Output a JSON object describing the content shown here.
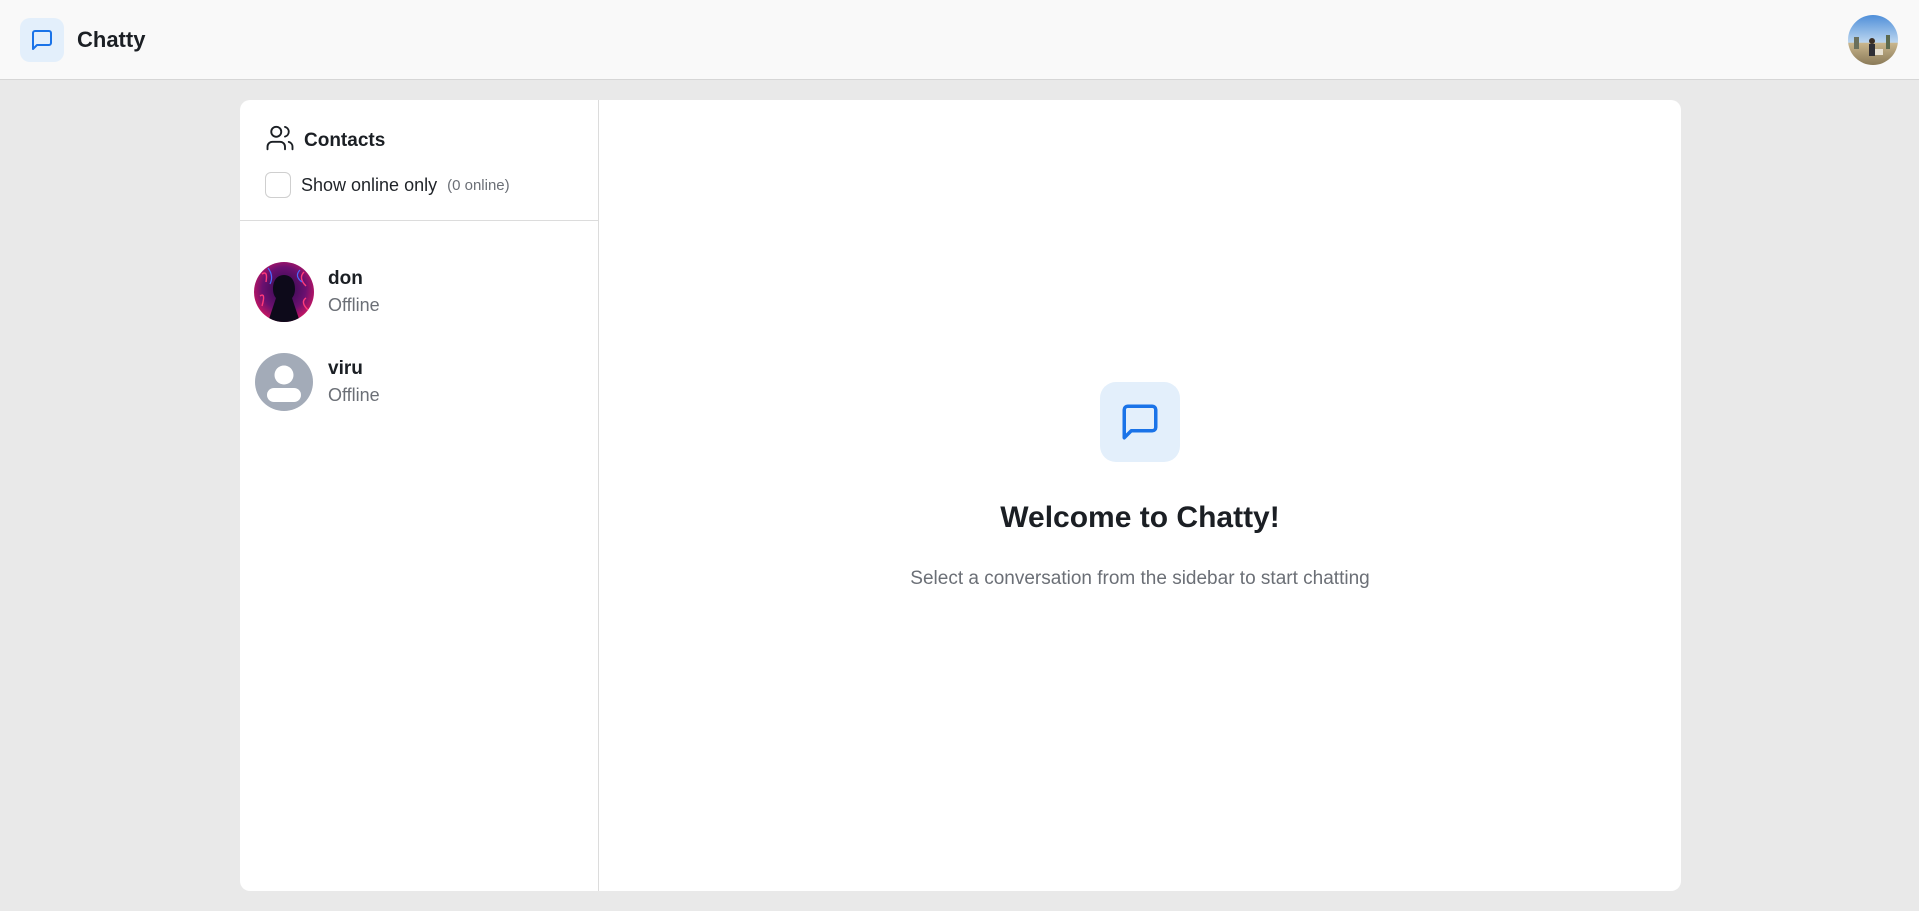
{
  "app": {
    "name": "Chatty",
    "accent_color": "#1a73e8",
    "accent_bg": "#e3effb"
  },
  "header": {
    "logo_icon": "message-square-icon",
    "user_avatar": "profile-photo"
  },
  "sidebar": {
    "title": "Contacts",
    "title_icon": "users-icon",
    "filter": {
      "label": "Show online only",
      "checked": false,
      "online_count": "(0 online)"
    },
    "contacts": [
      {
        "name": "don",
        "status": "Offline",
        "avatar": "hooded-figure-photo"
      },
      {
        "name": "viru",
        "status": "Offline",
        "avatar": "default-user-icon"
      }
    ]
  },
  "welcome": {
    "icon": "message-square-icon",
    "title": "Welcome to Chatty!",
    "subtitle": "Select a conversation from the sidebar to start chatting"
  }
}
